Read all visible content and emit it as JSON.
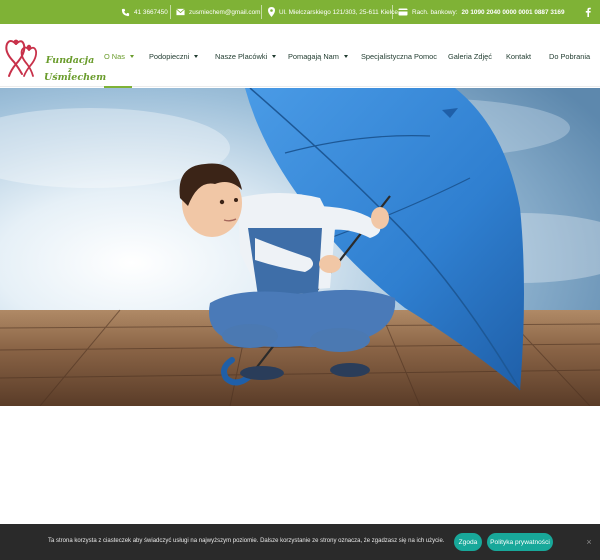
{
  "topbar": {
    "phone": "41 3667450",
    "email": "zusmiechem@gmail.com",
    "address": "Ul. Mielczarskiego 121/303, 25-611 Kielce",
    "bank_label": "Rach. bankowy:",
    "bank_number": "20 1090 2040 0000 0001 0887 3169",
    "social_icon": "facebook-icon"
  },
  "logo": {
    "line1": "Fundacja",
    "line2": "z",
    "line3": "Uśmiechem"
  },
  "nav": {
    "items": [
      {
        "label": "O Nas",
        "dropdown": true,
        "active": true
      },
      {
        "label": "Podopieczni",
        "dropdown": true
      },
      {
        "label": "Nasze Placówki",
        "dropdown": true
      },
      {
        "label": "Pomagają Nam",
        "dropdown": true
      },
      {
        "label": "Specjalistyczna Pomoc",
        "dropdown": false
      },
      {
        "label": "Galeria Zdjęć",
        "dropdown": false
      },
      {
        "label": "Kontakt",
        "dropdown": false
      },
      {
        "label": "Do Pobrania",
        "dropdown": false
      }
    ]
  },
  "cookie": {
    "text": "Ta strona korzysta z ciasteczek aby świadczyć usługi na najwyższym poziomie. Dalsze korzystanie ze strony oznacza, że zgadzasz się na ich użycie.",
    "accept": "Zgoda",
    "privacy": "Polityka prywatności",
    "close": "×"
  },
  "colors": {
    "topbar": "#7fb236",
    "brand_green": "#6a9c2c",
    "cookie_bg": "#2a2a2a",
    "cookie_button": "#18a89a",
    "umbrella": "#2f7fd0"
  }
}
